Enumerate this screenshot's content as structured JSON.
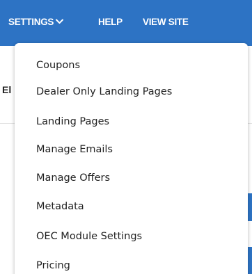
{
  "nav": {
    "settings_label": "SETTINGS",
    "help_label": "HELP",
    "view_site_label": "VIEW SITE"
  },
  "background": {
    "partial_heading": "El"
  },
  "settings_menu": {
    "items": [
      {
        "label": "Coupons"
      },
      {
        "label": "Dealer Only Landing Pages"
      },
      {
        "label": "Landing Pages"
      },
      {
        "label": "Manage Emails"
      },
      {
        "label": "Manage Offers"
      },
      {
        "label": "Metadata"
      },
      {
        "label": "OEC Module Settings"
      },
      {
        "label": "Pricing"
      }
    ]
  },
  "colors": {
    "nav_background": "#2d73c4",
    "nav_text": "#ffffff",
    "menu_text": "#222222"
  },
  "icons": {
    "settings_dropdown": "chevron-down-icon"
  }
}
